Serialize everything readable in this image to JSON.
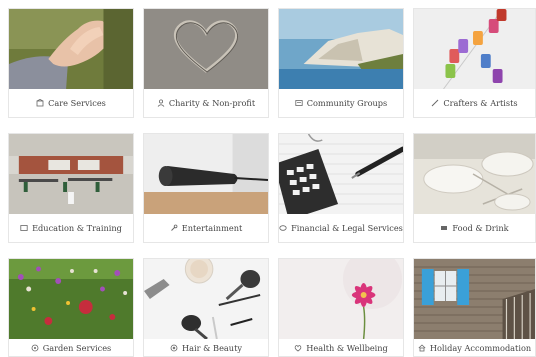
{
  "categories": [
    {
      "label": "Care Services",
      "icon": "care-icon"
    },
    {
      "label": "Charity & Non-profit",
      "icon": "charity-icon"
    },
    {
      "label": "Community Groups",
      "icon": "community-icon"
    },
    {
      "label": "Crafters & Artists",
      "icon": "brush-icon"
    },
    {
      "label": "Education & Training",
      "icon": "education-icon"
    },
    {
      "label": "Entertainment",
      "icon": "microphone-icon"
    },
    {
      "label": "Financial & Legal Services",
      "icon": "finance-icon"
    },
    {
      "label": "Food & Drink",
      "icon": "food-icon"
    },
    {
      "label": "Garden Services",
      "icon": "garden-icon"
    },
    {
      "label": "Hair & Beauty",
      "icon": "beauty-icon"
    },
    {
      "label": "Health & Wellbeing",
      "icon": "health-icon"
    },
    {
      "label": "Holiday Accommodation",
      "icon": "holiday-icon"
    }
  ]
}
